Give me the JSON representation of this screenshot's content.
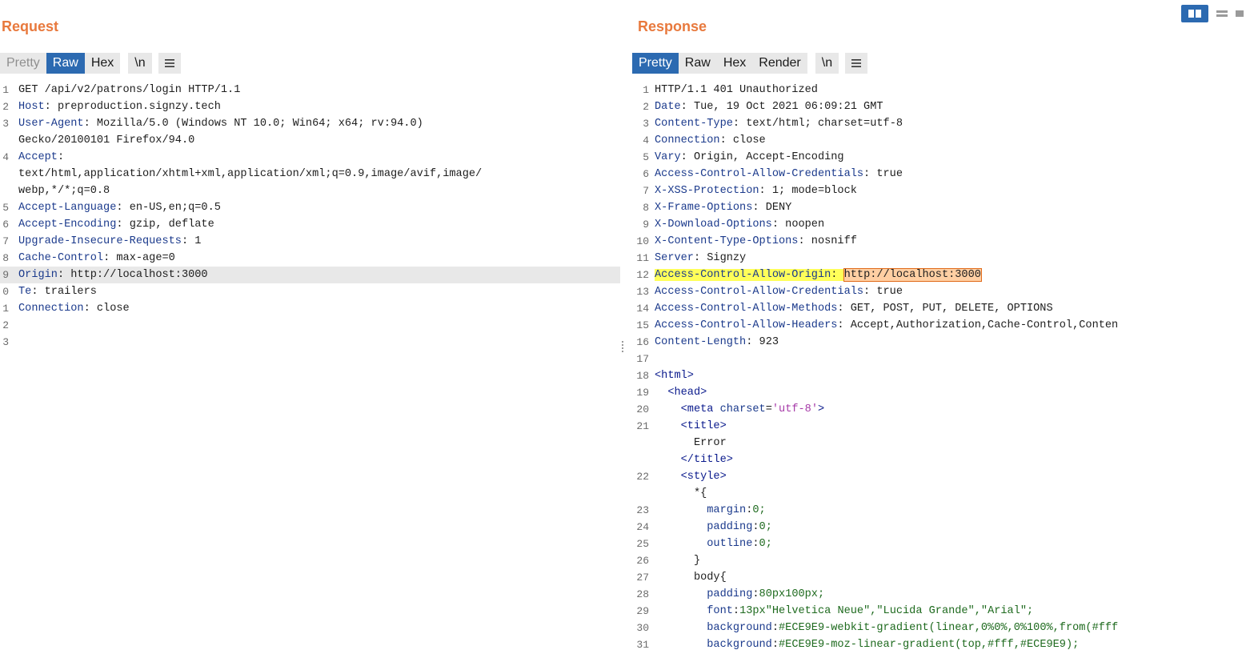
{
  "request": {
    "title": "Request",
    "tabs": [
      "Pretty",
      "Raw",
      "Hex",
      "\\n"
    ],
    "active_tab": "Raw",
    "lines": [
      {
        "n": "1",
        "key": "",
        "rest": "GET /api/v2/patrons/login HTTP/1.1"
      },
      {
        "n": "2",
        "key": "Host",
        "rest": ": preproduction.signzy.tech"
      },
      {
        "n": "3",
        "key": "User-Agent",
        "rest": ": Mozilla/5.0 (Windows NT 10.0; Win64; x64; rv:94.0)"
      },
      {
        "n": "",
        "key": "",
        "rest": "Gecko/20100101 Firefox/94.0"
      },
      {
        "n": "4",
        "key": "Accept",
        "rest": ":"
      },
      {
        "n": "",
        "key": "",
        "rest": "text/html,application/xhtml+xml,application/xml;q=0.9,image/avif,image/"
      },
      {
        "n": "",
        "key": "",
        "rest": "webp,*/*;q=0.8"
      },
      {
        "n": "5",
        "key": "Accept-Language",
        "rest": ": en-US,en;q=0.5"
      },
      {
        "n": "6",
        "key": "Accept-Encoding",
        "rest": ": gzip, deflate"
      },
      {
        "n": "7",
        "key": "Upgrade-Insecure-Requests",
        "rest": ": 1"
      },
      {
        "n": "8",
        "key": "Cache-Control",
        "rest": ": max-age=0"
      },
      {
        "n": "9",
        "key": "Origin",
        "rest": ": http://localhost:3000"
      },
      {
        "n": "0",
        "key": "Te",
        "rest": ": trailers"
      },
      {
        "n": "1",
        "key": "Connection",
        "rest": ": close"
      },
      {
        "n": "2",
        "key": "",
        "rest": ""
      },
      {
        "n": "3",
        "key": "",
        "rest": ""
      }
    ]
  },
  "response": {
    "title": "Response",
    "tabs": [
      "Pretty",
      "Raw",
      "Hex",
      "Render",
      "\\n"
    ],
    "active_tab": "Pretty",
    "headers": [
      {
        "n": "1",
        "key": "",
        "rest": "HTTP/1.1 401 Unauthorized"
      },
      {
        "n": "2",
        "key": "Date",
        "rest": ": Tue, 19 Oct 2021 06:09:21 GMT"
      },
      {
        "n": "3",
        "key": "Content-Type",
        "rest": ": text/html; charset=utf-8"
      },
      {
        "n": "4",
        "key": "Connection",
        "rest": ": close"
      },
      {
        "n": "5",
        "key": "Vary",
        "rest": ": Origin, Accept-Encoding"
      },
      {
        "n": "6",
        "key": "Access-Control-Allow-Credentials",
        "rest": ": true"
      },
      {
        "n": "7",
        "key": "X-XSS-Protection",
        "rest": ": 1; mode=block"
      },
      {
        "n": "8",
        "key": "X-Frame-Options",
        "rest": ": DENY"
      },
      {
        "n": "9",
        "key": "X-Download-Options",
        "rest": ": noopen"
      },
      {
        "n": "10",
        "key": "X-Content-Type-Options",
        "rest": ": nosniff"
      },
      {
        "n": "11",
        "key": "Server",
        "rest": ": Signzy"
      },
      {
        "n": "12",
        "key": "Access-Control-Allow-Origin",
        "rest": "http://localhost:3000"
      },
      {
        "n": "13",
        "key": "Access-Control-Allow-Credentials",
        "rest": ": true"
      },
      {
        "n": "14",
        "key": "Access-Control-Allow-Methods",
        "rest": ": GET, POST, PUT, DELETE, OPTIONS"
      },
      {
        "n": "15",
        "key": "Access-Control-Allow-Headers",
        "rest": ": Accept,Authorization,Cache-Control,Conten"
      },
      {
        "n": "16",
        "key": "Content-Length",
        "rest": ": 923"
      },
      {
        "n": "17",
        "key": "",
        "rest": ""
      }
    ],
    "body": [
      {
        "n": "18",
        "text": "<html>"
      },
      {
        "n": "19",
        "text": "  <head>"
      },
      {
        "n": "20",
        "text": "    <meta charset='utf-8'>"
      },
      {
        "n": "21",
        "text": "    <title>"
      },
      {
        "n": "",
        "text": "      Error"
      },
      {
        "n": "",
        "text": "    </title>"
      },
      {
        "n": "22",
        "text": "    <style>"
      },
      {
        "n": "",
        "text": "      *{"
      },
      {
        "n": "23",
        "text": "        margin:0;"
      },
      {
        "n": "24",
        "text": "        padding:0;"
      },
      {
        "n": "25",
        "text": "        outline:0;"
      },
      {
        "n": "26",
        "text": "      }"
      },
      {
        "n": "27",
        "text": "      body{"
      },
      {
        "n": "28",
        "text": "        padding:80px100px;"
      },
      {
        "n": "29",
        "text": "        font:13px\"Helvetica Neue\",\"Lucida Grande\",\"Arial\";"
      },
      {
        "n": "30",
        "text": "        background:#ECE9E9-webkit-gradient(linear,0%0%,0%100%,from(#fff"
      },
      {
        "n": "31",
        "text": "        background:#ECE9E9-moz-linear-gradient(top,#fff,#ECE9E9);"
      }
    ]
  },
  "layout_toggle": {
    "options": [
      "split-vertical-icon",
      "split-horizontal-icon",
      "single-pane-icon"
    ],
    "active": "split-vertical-icon"
  },
  "colors": {
    "title": "#e8793d",
    "active_tab": "#2c6ab1",
    "header_key": "#1b3a8c",
    "highlight_key": "#ffff59",
    "highlight_value": "#ffcfa3"
  }
}
